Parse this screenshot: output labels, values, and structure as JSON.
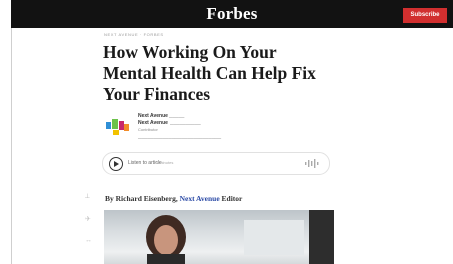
{
  "header": {
    "brand": "Forbes",
    "subscribe_label": "Subscribe"
  },
  "article": {
    "kicker": "NEXT AVENUE · FORBES",
    "headline": "How Working On Your Mental Health Can Help Fix Your Finances",
    "author_block": {
      "name_primary": "Next Avenue",
      "name_secondary": "Next Avenue",
      "role": "Contributor"
    },
    "listen": {
      "label": "Listen to article",
      "duration": "5 minutes"
    },
    "byline": {
      "prefix": "By Richard Eisenberg,",
      "link": "Next Avenue",
      "suffix": "Editor"
    }
  },
  "icons": [
    "forbes-logo",
    "subscribe-button",
    "next-avenue-logo-icon",
    "play-icon",
    "audio-wave-icon",
    "share-icon",
    "twitter-icon",
    "linkedin-icon"
  ],
  "colors": {
    "header_bg": "#121212",
    "subscribe_bg": "#d12f2f",
    "link": "#2b4aa6",
    "text": "#1a1a1a"
  }
}
